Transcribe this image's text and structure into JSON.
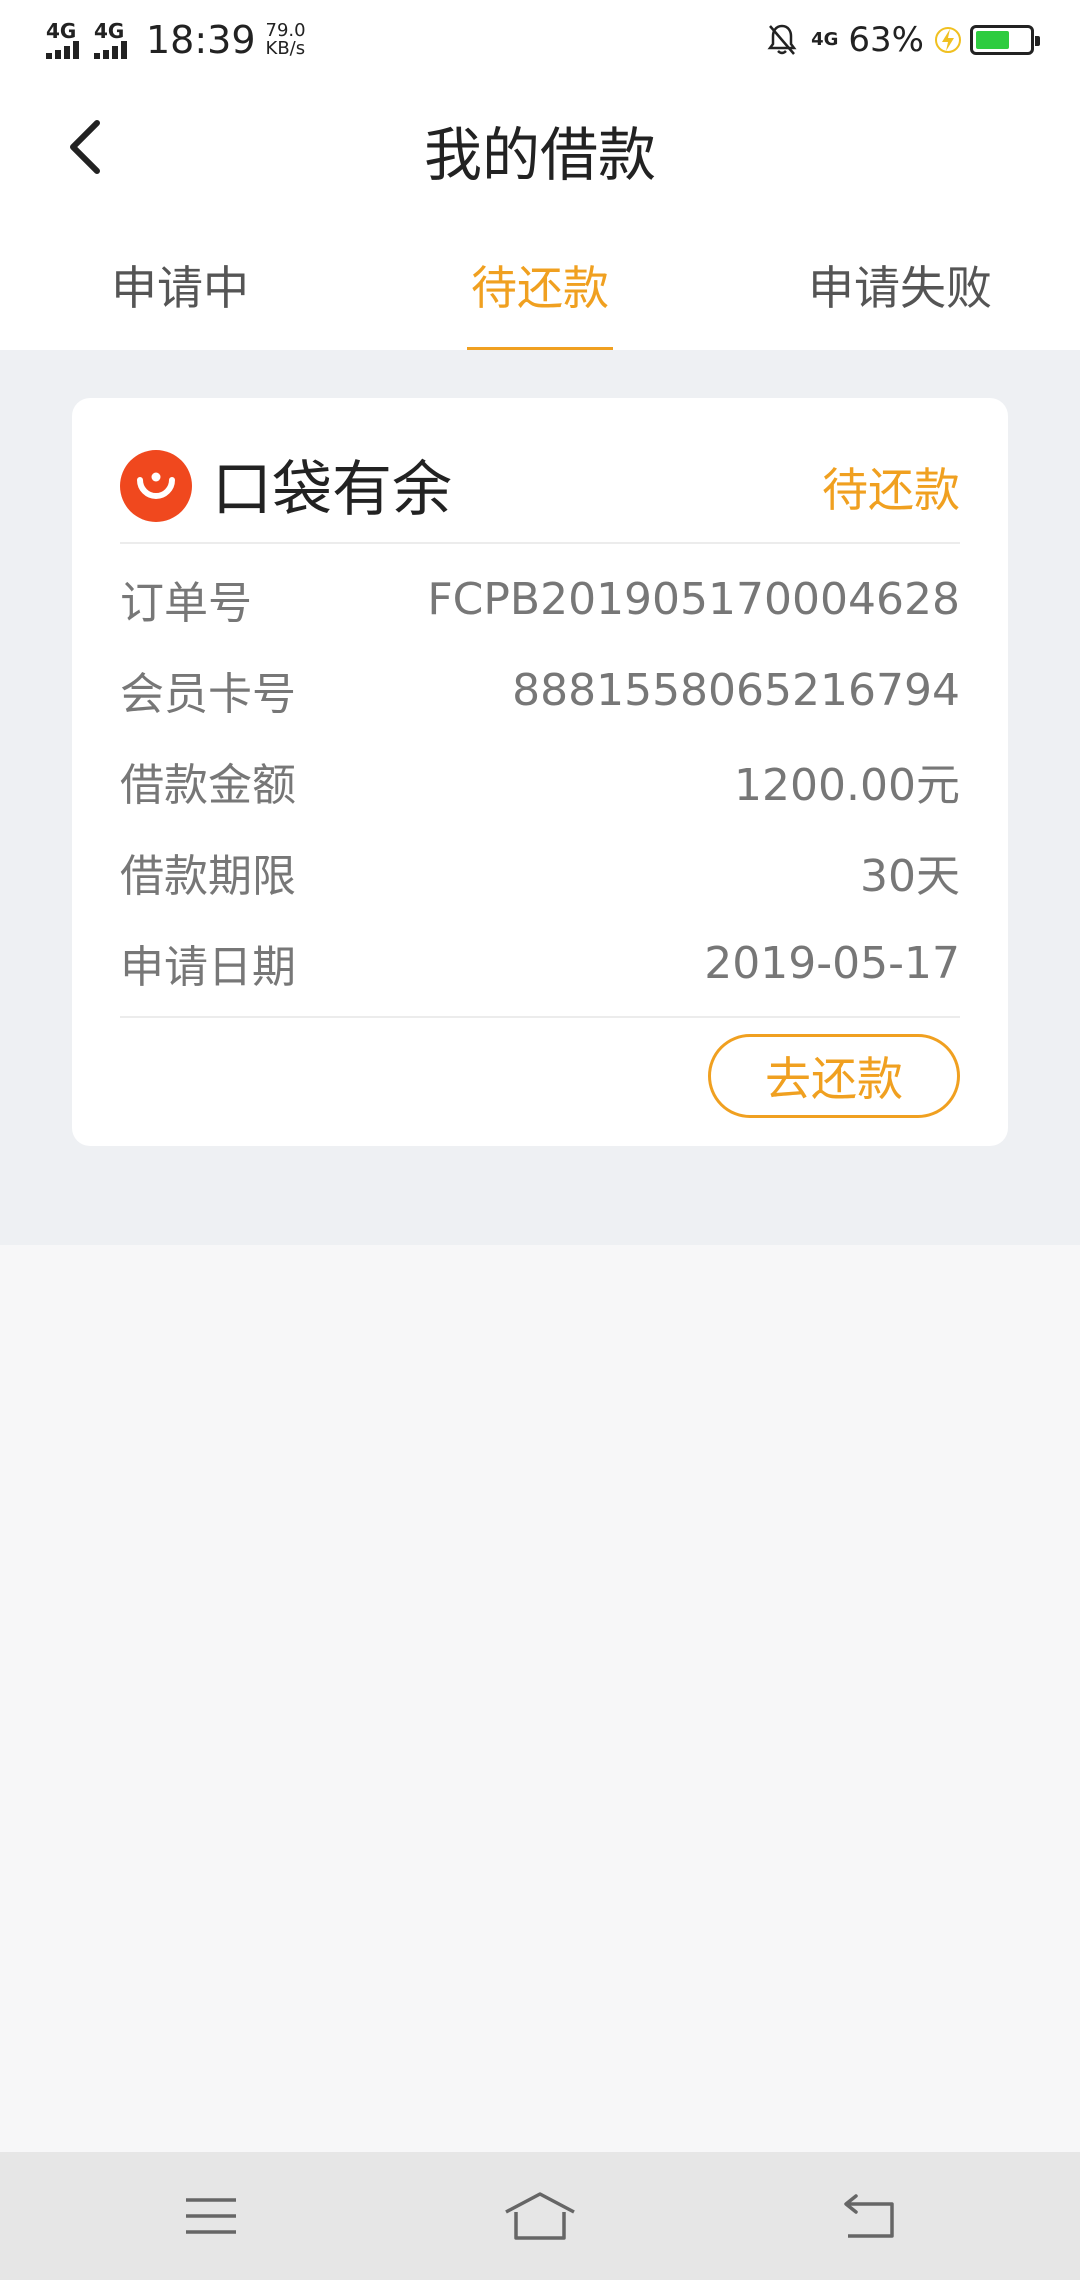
{
  "status_bar": {
    "net_1": "4G",
    "net_2": "4G",
    "time": "18:39",
    "speed_value": "79.0",
    "speed_unit": "KB/s",
    "net_right": "4G",
    "battery_percent": "63%",
    "battery_level": 0.63,
    "battery_color": "#2ecc40"
  },
  "header": {
    "title": "我的借款",
    "back_icon": "chevron-left-icon"
  },
  "tabs": [
    {
      "label": "申请中",
      "active": false
    },
    {
      "label": "待还款",
      "active": true
    },
    {
      "label": "申请失败",
      "active": false
    }
  ],
  "accent_color": "#f0a020",
  "card": {
    "brand_icon": "brand-logo-icon",
    "brand_color": "#f0481e",
    "brand_name": "口袋有余",
    "status": "待还款",
    "rows": [
      {
        "label": "订单号",
        "value": "FCPB201905170004628"
      },
      {
        "label": "会员卡号",
        "value": "8881558065216794"
      },
      {
        "label": "借款金额",
        "value": "1200.00元"
      },
      {
        "label": "借款期限",
        "value": "30天"
      },
      {
        "label": "申请日期",
        "value": "2019-05-17"
      }
    ],
    "action_label": "去还款"
  },
  "nav_bar": {
    "menu_icon": "menu-icon",
    "home_icon": "home-icon",
    "back_icon": "back-icon"
  }
}
